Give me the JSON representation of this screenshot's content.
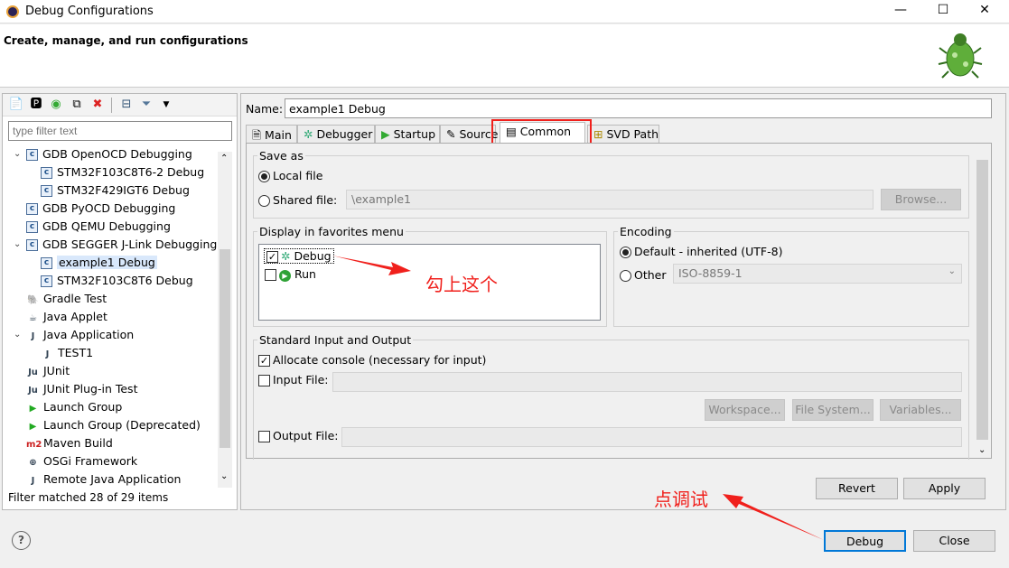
{
  "window": {
    "title": "Debug Configurations",
    "minimize": "—",
    "maximize": "☐",
    "close": "✕"
  },
  "header": {
    "title": "Create, manage, and run configurations"
  },
  "left": {
    "filter_placeholder": "type filter text",
    "tree": [
      {
        "label": "GDB OpenOCD Debugging",
        "level": 0,
        "expanded": true,
        "icon": "c"
      },
      {
        "label": "STM32F103C8T6-2 Debug",
        "level": 1,
        "icon": "c"
      },
      {
        "label": "STM32F429IGT6 Debug",
        "level": 1,
        "icon": "c"
      },
      {
        "label": "GDB PyOCD Debugging",
        "level": 0,
        "icon": "c"
      },
      {
        "label": "GDB QEMU Debugging",
        "level": 0,
        "icon": "c"
      },
      {
        "label": "GDB SEGGER J-Link Debugging",
        "level": 0,
        "expanded": true,
        "icon": "c"
      },
      {
        "label": "example1 Debug",
        "level": 1,
        "icon": "c",
        "selected": true
      },
      {
        "label": "STM32F103C8T6 Debug",
        "level": 1,
        "icon": "c"
      },
      {
        "label": "Gradle Test",
        "level": 0,
        "icon": "gradle"
      },
      {
        "label": "Java Applet",
        "level": 0,
        "icon": "applet"
      },
      {
        "label": "Java Application",
        "level": 0,
        "expanded": true,
        "icon": "J"
      },
      {
        "label": "TEST1",
        "level": 1,
        "icon": "J"
      },
      {
        "label": "JUnit",
        "level": 0,
        "icon": "Ju"
      },
      {
        "label": "JUnit Plug-in Test",
        "level": 0,
        "icon": "Ju"
      },
      {
        "label": "Launch Group",
        "level": 0,
        "icon": "play"
      },
      {
        "label": "Launch Group (Deprecated)",
        "level": 0,
        "icon": "play"
      },
      {
        "label": "Maven Build",
        "level": 0,
        "icon": "m2"
      },
      {
        "label": "OSGi Framework",
        "level": 0,
        "icon": "osgi"
      },
      {
        "label": "Remote Java Application",
        "level": 0,
        "icon": "J"
      }
    ],
    "status": "Filter matched 28 of 29 items"
  },
  "main": {
    "name_label": "Name:",
    "name_value": "example1 Debug",
    "tabs": [
      "Main",
      "Debugger",
      "Startup",
      "Source",
      "Common",
      "SVD Path"
    ],
    "active_tab": "Common",
    "save_as": {
      "legend": "Save as",
      "local": "Local file",
      "shared": "Shared file:",
      "shared_value": "\\example1",
      "browse": "Browse..."
    },
    "favorites": {
      "legend": "Display in favorites menu",
      "items": [
        {
          "label": "Debug",
          "checked": true
        },
        {
          "label": "Run",
          "checked": false
        }
      ]
    },
    "encoding": {
      "legend": "Encoding",
      "default": "Default - inherited (UTF-8)",
      "other": "Other",
      "other_value": "ISO-8859-1"
    },
    "stdio": {
      "legend": "Standard Input and Output",
      "allocate": "Allocate console (necessary for input)",
      "input_file": "Input File:",
      "output_file": "Output File:",
      "workspace": "Workspace...",
      "filesystem": "File System...",
      "variables": "Variables..."
    },
    "revert": "Revert",
    "apply": "Apply"
  },
  "footer": {
    "debug": "Debug",
    "close": "Close"
  },
  "annotations": {
    "check_this": "勾上这个",
    "click_debug": "点调试"
  },
  "colors": {
    "annotation": "#f0201c",
    "selection": "#d9e8fb"
  }
}
